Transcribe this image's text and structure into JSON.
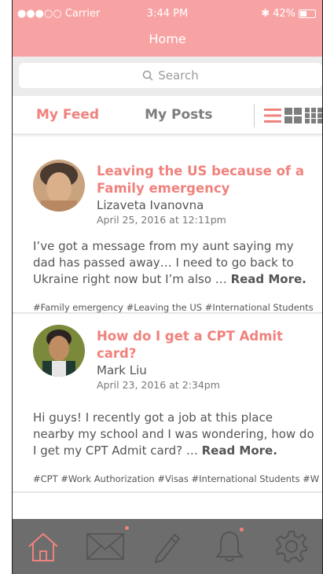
{
  "status": {
    "carrier": "●●●○○ Carrier",
    "time": "3:44 PM",
    "battery": "42%",
    "battery_level": 0.42
  },
  "nav": {
    "title": "Home"
  },
  "search": {
    "placeholder": "Search"
  },
  "tabs": {
    "feed": "My Feed",
    "posts": "My Posts"
  },
  "posts": [
    {
      "title": "Leaving the US because of a Family emergency",
      "author": "Lizaveta Ivanovna",
      "date": "April 25, 2016 at 12:11pm",
      "body": "I’ve got a message from my aunt saying my dad has passed away… I need to go back to Ukraine right now but I’m also … ",
      "readmore": "Read More.",
      "tags": "#Family emergency #Leaving the US #International Students"
    },
    {
      "title": "How do I get a CPT Admit card?",
      "author": "Mark Liu",
      "date": "April 23, 2016 at 2:34pm",
      "body": "Hi guys! I recently got a job at this place nearby my school and I was wondering, how do I get my CPT Admit card? … ",
      "readmore": "Read More.",
      "tags": "#CPT #Work Authorization #Visas #International Students #W"
    }
  ],
  "colors": {
    "header": "#f8a3a3",
    "accent": "#f0827d",
    "tabbar": "#6d6d6d"
  },
  "tabbar_icons": [
    "home-icon",
    "mail-icon",
    "pencil-icon",
    "bell-icon",
    "gear-icon"
  ]
}
